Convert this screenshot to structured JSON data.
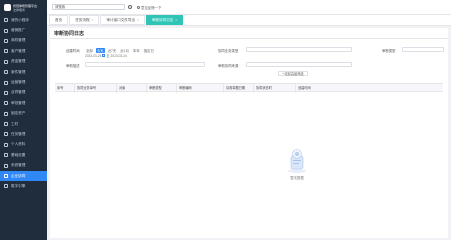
{
  "app": {
    "name": "智慧律所管理平台",
    "subtitle": "法律服务"
  },
  "sidebar": {
    "items": [
      {
        "label": "我的小程序"
      },
      {
        "label": "营销推广"
      },
      {
        "label": "商机管理"
      },
      {
        "label": "客户管理"
      },
      {
        "label": "资金管理"
      },
      {
        "label": "案件管理"
      },
      {
        "label": "运营管理"
      },
      {
        "label": "合同管理"
      },
      {
        "label": "审批管理"
      },
      {
        "label": "固定资产"
      },
      {
        "label": "工时"
      },
      {
        "label": "任务管理"
      },
      {
        "label": "个人资料"
      },
      {
        "label": "基础设置"
      },
      {
        "label": "系统管理"
      },
      {
        "label": "企业协同"
      },
      {
        "label": "数字引擎"
      }
    ],
    "active_index": 15
  },
  "topbar": {
    "search_value": "请搜索",
    "feedback_label": "意见反馈一下"
  },
  "tabs": [
    {
      "label": "首页",
      "closable": false
    },
    {
      "label": "任务流程",
      "closable": true
    },
    {
      "label": "审计接口文件导出",
      "closable": true
    },
    {
      "label": "审断协同日志",
      "closable": true,
      "active": true
    }
  ],
  "page": {
    "title": "审断协同日志",
    "filters": {
      "time_label": "创建时间",
      "time_options": [
        "全部",
        "今天",
        "近7天",
        "近1月",
        "本年",
        "指定日"
      ],
      "time_active_index": 1,
      "date_from": "2023-03-24",
      "date_to": "2023-03-24",
      "date_sep": "至",
      "type_label": "协同业务类型",
      "type_placeholder": "请选择",
      "type2_label": "审断类型",
      "type2_placeholder": "请选择",
      "content_label": "审断描述",
      "content_placeholder": "请输入",
      "source_label": "审断协同来源",
      "source_placeholder": "请选择",
      "collapse_label": "收起高级筛选"
    },
    "table": {
      "columns": [
        "序号",
        "协同业务单号",
        "对象",
        "审断类型",
        "审断编码",
        "请收单据日期",
        "协同状态时",
        "创建时间"
      ]
    },
    "empty_text": "暂无数据"
  }
}
